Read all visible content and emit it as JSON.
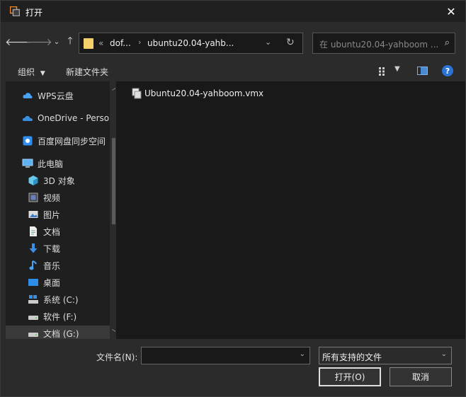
{
  "window": {
    "title": "打开"
  },
  "nav": {
    "back_icon": "arrow-left-icon",
    "forward_icon": "arrow-right-icon",
    "recent_icon": "chevron-down-icon",
    "up_icon": "arrow-up-icon"
  },
  "address": {
    "overflow": "«",
    "crumbs": [
      "dof...",
      "ubuntu20.04-yahb..."
    ]
  },
  "search": {
    "placeholder": "在 ubuntu20.04-yahboom ..."
  },
  "toolbar": {
    "organize_label": "组织",
    "new_folder_label": "新建文件夹"
  },
  "sidebar": {
    "items": [
      {
        "label": "WPS云盘",
        "icon": "wps-cloud-icon"
      },
      {
        "label": "OneDrive - Perso",
        "icon": "onedrive-icon"
      },
      {
        "label": "百度网盘同步空间",
        "icon": "baidu-netdisk-icon"
      },
      {
        "label": "此电脑",
        "icon": "computer-icon"
      },
      {
        "label": "3D 对象",
        "icon": "cube-3d-icon"
      },
      {
        "label": "视频",
        "icon": "video-icon"
      },
      {
        "label": "图片",
        "icon": "picture-icon"
      },
      {
        "label": "文档",
        "icon": "document-icon"
      },
      {
        "label": "下载",
        "icon": "download-icon"
      },
      {
        "label": "音乐",
        "icon": "music-icon"
      },
      {
        "label": "桌面",
        "icon": "desktop-icon"
      },
      {
        "label": "系统 (C:)",
        "icon": "system-drive-icon"
      },
      {
        "label": "软件 (F:)",
        "icon": "drive-icon"
      },
      {
        "label": "文档 (G:)",
        "icon": "drive-icon"
      }
    ]
  },
  "files": [
    {
      "name": "Ubuntu20.04-yahboom.vmx",
      "icon": "vmx-file-icon"
    }
  ],
  "bottom": {
    "filename_label": "文件名(N):",
    "filename_value": "",
    "filetype_value": "所有支持的文件",
    "open_label": "打开(O)",
    "cancel_label": "取消"
  },
  "colors": {
    "accent": "#2a72d4",
    "folder": "#f3d06b",
    "background": "#2b2b2b"
  }
}
